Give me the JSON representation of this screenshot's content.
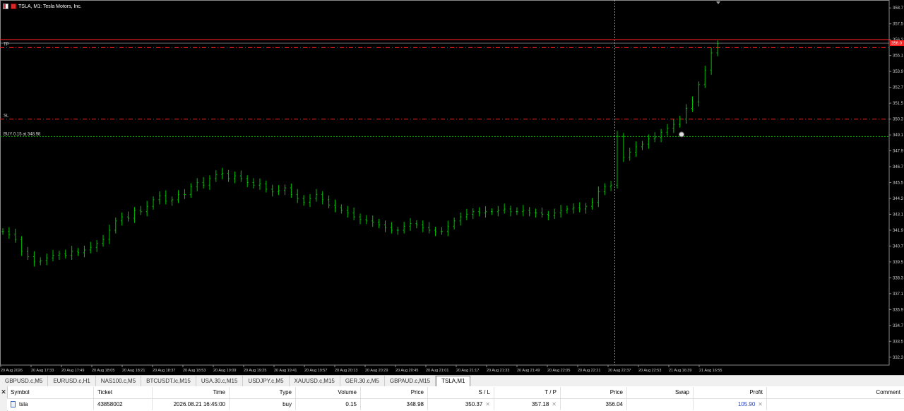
{
  "chart": {
    "title": "TSLA, M1:  Tesla Motors, Inc.",
    "levels": {
      "tp_label": "TP",
      "sl_label": "SL",
      "buy_label": "BUY 0.15 at 348.98",
      "tp_price": 355.7,
      "sl_price": 350.3,
      "entry_price": 348.98,
      "current_price_label": "356.0",
      "current_price": 356.04,
      "red_line_price": 356.3
    },
    "colors": {
      "background": "#000000",
      "bars": "#00c000",
      "levels": "#ff2020",
      "entry": "#00c000",
      "axis_text": "#cccccc"
    },
    "y_axis_labels": [
      "358.7",
      "357.5",
      "356.3",
      "355.1",
      "353.9",
      "352.7",
      "351.5",
      "350.3",
      "349.1",
      "347.9",
      "346.7",
      "345.5",
      "344.3",
      "343.1",
      "341.9",
      "340.7",
      "339.5",
      "338.3",
      "337.1",
      "335.9",
      "334.7",
      "333.5",
      "332.3"
    ],
    "x_axis_labels": [
      "20 Aug 2026",
      "20 Aug 17:33",
      "20 Aug 17:49",
      "20 Aug 18:05",
      "20 Aug 18:21",
      "20 Aug 18:37",
      "20 Aug 18:53",
      "20 Aug 19:09",
      "20 Aug 19:25",
      "20 Aug 19:41",
      "20 Aug 19:57",
      "20 Aug 20:13",
      "20 Aug 20:29",
      "20 Aug 20:45",
      "20 Aug 21:01",
      "20 Aug 21:17",
      "20 Aug 21:33",
      "20 Aug 21:49",
      "20 Aug 22:05",
      "20 Aug 22:21",
      "20 Aug 22:37",
      "20 Aug 22:53",
      "21 Aug 16:39",
      "21 Aug 16:55"
    ]
  },
  "chart_data": {
    "type": "line",
    "series": [
      {
        "values": [
          341.8,
          341.6,
          341.2,
          340.3,
          339.9,
          339.5,
          339.6,
          339.8,
          340.0,
          340.1,
          340.0,
          340.3,
          340.2,
          340.4,
          340.6,
          340.9,
          341.2,
          341.9,
          342.6,
          342.9,
          342.8,
          343.4,
          343.3,
          343.7,
          344.2,
          344.5,
          344.1,
          344.2,
          344.6,
          344.6,
          345.2,
          345.5,
          345.3,
          345.8,
          346.1,
          346.2,
          345.8,
          346.0,
          345.8,
          345.5,
          345.3,
          345.4,
          345.0,
          344.8,
          344.9,
          345.1,
          344.6,
          344.3,
          344.0,
          344.3,
          344.6,
          344.2,
          343.8,
          343.6,
          343.4,
          343.2,
          342.9,
          342.7,
          342.6,
          342.5,
          342.3,
          342.1,
          341.9,
          341.9,
          342.2,
          342.4,
          342.3,
          342.1,
          341.9,
          341.8,
          341.8,
          342.2,
          342.6,
          342.9,
          343.1,
          343.3,
          343.2,
          343.3,
          343.3,
          343.4,
          343.5,
          343.3,
          343.3,
          343.4,
          343.2,
          343.2,
          343.1,
          343.0,
          343.2,
          343.4,
          343.5,
          343.6,
          343.5,
          343.7,
          344.0,
          344.8,
          345.2,
          345.3,
          349.0,
          347.4,
          347.8,
          348.2,
          348.4,
          348.8,
          348.9,
          349.3,
          349.6,
          349.9,
          350.3,
          351.1,
          351.6,
          352.9,
          354.0,
          355.3,
          356.0
        ]
      }
    ],
    "ylim": [
      331.7,
      359.3
    ],
    "grid": false
  },
  "tabs": [
    {
      "label": "GBPUSD.c,M5"
    },
    {
      "label": "EURUSD.c,H1"
    },
    {
      "label": "NAS100.c,M5"
    },
    {
      "label": "BTCUSDT.lc,M15"
    },
    {
      "label": "USA.30.c,M15"
    },
    {
      "label": "USDJPY.c,M5"
    },
    {
      "label": "XAUUSD.c,M15"
    },
    {
      "label": "GER.30.c,M5"
    },
    {
      "label": "GBPAUD.c,M15"
    },
    {
      "label": "TSLA,M1",
      "active": true
    }
  ],
  "table": {
    "columns": [
      "Symbol",
      "Ticket",
      "Time",
      "Type",
      "Volume",
      "Price",
      "S / L",
      "T / P",
      "Price",
      "Swap",
      "Profit",
      "Comment"
    ],
    "row": {
      "symbol": "tsla",
      "ticket": "43858002",
      "time": "2026.08.21 16:45:00",
      "type": "buy",
      "volume": "0.15",
      "price": "348.98",
      "sl": "350.37",
      "tp": "357.18",
      "current_price": "356.04",
      "swap": "",
      "profit": "105.90",
      "comment": ""
    }
  }
}
